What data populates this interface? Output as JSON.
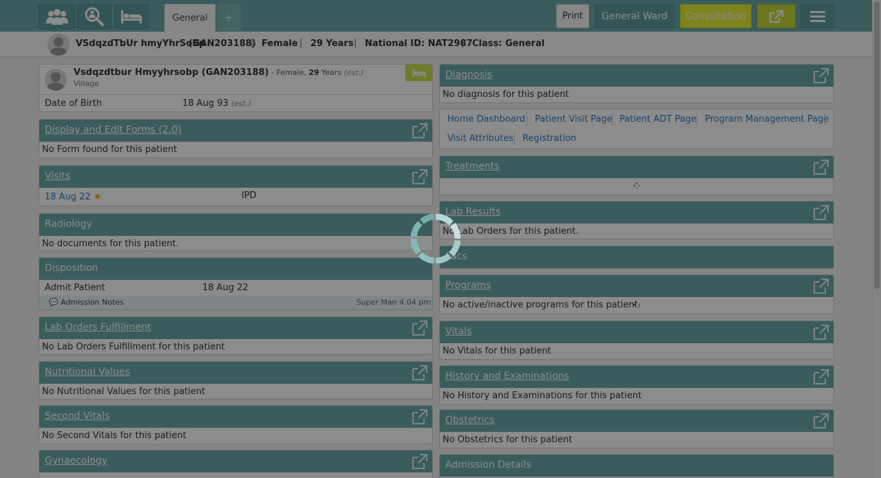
{
  "header": {
    "tabs": {
      "active": "General",
      "add": "+"
    },
    "print_label": "Print",
    "ward_label": "General Ward",
    "consultation_label": "Consultation",
    "icons": [
      "patients-icon",
      "search-patient-icon",
      "bed-icon",
      "external-link-icon",
      "hamburger-menu-icon"
    ]
  },
  "patient_bar": {
    "name": "VSdqzdTbUr hmyYhrSoBp",
    "id": "(GAN203188)",
    "gender": "Female",
    "age": "29 Years",
    "national_id": "National ID: NAT2987",
    "class": "Class: General",
    "separator": "|"
  },
  "left": {
    "profile": {
      "name_id": "Vsdqzdtbur Hmyyhrsobp (GAN203188)",
      "gender_sep": " - Female, ",
      "age_num": "29",
      "age_word": " Years ",
      "est": "(est.)",
      "address": "Village",
      "dob_label": "Date of Birth",
      "dob_value": "18 Aug 93",
      "dob_est": "(est.)"
    },
    "forms": {
      "title": "Display and Edit Forms (2.0)",
      "empty": "No Form found for this patient"
    },
    "visits": {
      "title": "Visits",
      "date": "18 Aug 22",
      "type": "IPD"
    },
    "radiology": {
      "title": "Radiology",
      "empty": "No documents for this patient."
    },
    "disposition": {
      "title": "Disposition",
      "action": "Admit Patient",
      "date": "18 Aug 22",
      "notes": "Admission Notes",
      "author": "Super Man 4:04 pm"
    },
    "lab_fulfillment": {
      "title": "Lab Orders Fulfillment",
      "empty": "No Lab Orders Fulfillment for this patient"
    },
    "nutritional": {
      "title": "Nutritional Values",
      "empty": "No Nutritional Values for this patient"
    },
    "second_vitals": {
      "title": "Second Vitals",
      "empty": "No Second Vitals for this patient"
    },
    "gynaecology": {
      "title": "Gynaecology"
    }
  },
  "right": {
    "diagnosis": {
      "title": "Diagnosis",
      "empty": "No diagnosis for this patient"
    },
    "links": {
      "home": "Home Dashboard",
      "visit": "Patient Visit Page",
      "adt": "Patient ADT Page",
      "program": "Program Management Page",
      "attributes": "Visit Attributes",
      "registration": "Registration"
    },
    "treatments": {
      "title": "Treatments"
    },
    "lab_results": {
      "title": "Lab Results",
      "empty": "No Lab Orders for this patient."
    },
    "pacs": {
      "title": "Pacs"
    },
    "programs": {
      "title": "Programs",
      "empty": "No active/inactive programs for this patient."
    },
    "vitals": {
      "title": "Vitals",
      "empty": "No Vitals for this patient"
    },
    "history": {
      "title": "History and Examinations",
      "empty": "No History and Examinations for this patient"
    },
    "obstetrics": {
      "title": "Obstetrics",
      "empty": "No Obstetrics for this patient"
    },
    "admission": {
      "title": "Admission Details"
    }
  },
  "colors": {
    "teal": "#6aa8a8",
    "teal_dark": "#5e9c9c",
    "consult_yellow": "#e8ee3a",
    "ext_green": "#c5d73a",
    "bed_badge": "#c9e04a",
    "link": "#2f7bbf",
    "star": "#f5a623"
  }
}
